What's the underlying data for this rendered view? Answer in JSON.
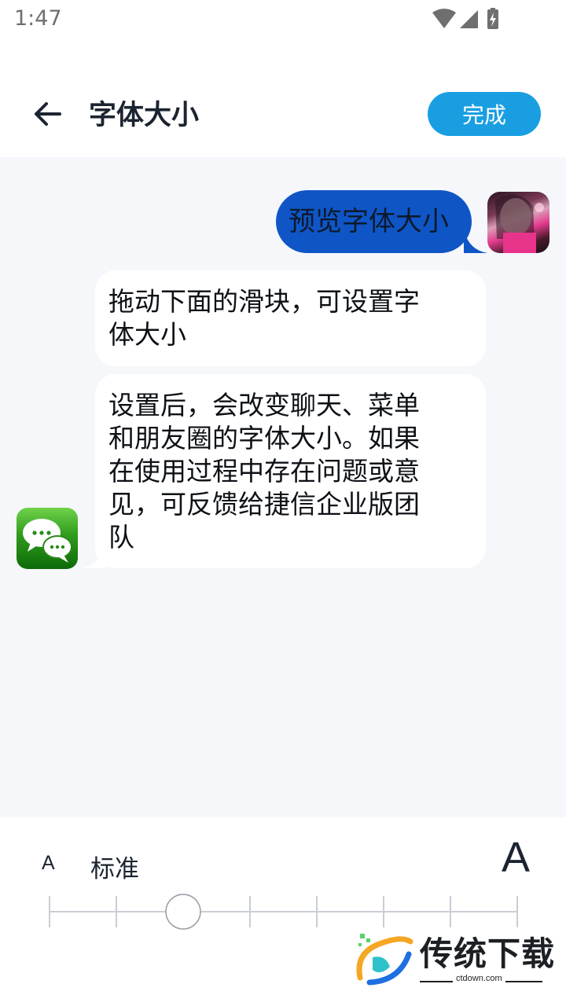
{
  "status_bar": {
    "time": "1:47",
    "icons": [
      "wifi-icon",
      "cell-signal-icon",
      "battery-charging-icon"
    ]
  },
  "header": {
    "back_icon": "arrow-left-icon",
    "title": "字体大小",
    "done_label": "完成"
  },
  "chat": {
    "outgoing": {
      "text": "预览字体大小",
      "avatar": "user-photo"
    },
    "incoming": [
      {
        "text_lines": [
          "拖动下面的滑块，可设置字",
          "体大小"
        ]
      },
      {
        "text_lines": [
          "设置后，会改变聊天、菜单",
          "和朋友圈的字体大小。如果",
          "在使用过程中存在问题或意",
          "见，可反馈给捷信企业版团",
          "队"
        ]
      }
    ],
    "bot_avatar": "chat-bubbles-icon"
  },
  "font_control": {
    "small_label": "A",
    "level_label": "标准",
    "large_label": "A",
    "steps": 8,
    "selected_step": 2
  },
  "watermark": {
    "title": "传统下载",
    "subtitle": "ctdown.com"
  },
  "colors": {
    "accent": "#1a9ee2",
    "outgoing_bubble": "#0f55c6",
    "chat_background": "#f5f7fb"
  }
}
